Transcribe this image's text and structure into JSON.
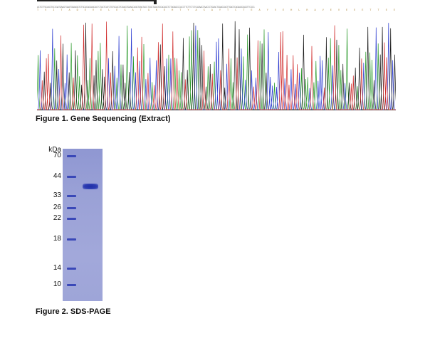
{
  "figure1": {
    "caption": "Figure 1. Gene Sequencing (Extract)",
    "base_sequence": "ACTGTTGCAGCTGCCGATGAAGTGAATGGAAGGTCTGCACAGGAGCACTCTACTCATCTGTGCACTATAAGTGAAGCAGGTGAGTACCTGGCTAAGTGCACAGCTCTAGAGCCCACCTTCTTCTCTCAGAACTAACCCTGAACTGAAGCAGTTGAGTCAGAAGCAGGTTCGCG",
    "aa_sequence": "T V I T A D E V E L E G A T G K E H T Y A S A Y T C T E A Y V E H L R A V E V E E E T T E E K P R L K E P F P F T L A A L I R G E G S E",
    "trace_colors": {
      "A": "#2a9a2a",
      "C": "#2b3bd0",
      "G": "#1a1a1a",
      "T": "#d02a2a"
    }
  },
  "figure2": {
    "caption": "Figure 2. SDS-PAGE",
    "unit_label": "kDa",
    "ladder_kda": [
      70,
      44,
      33,
      26,
      22,
      18,
      14,
      10
    ],
    "sample_band_kda": 38,
    "gel_color": "#9aa1d6",
    "band_color": "#2d3cb2"
  }
}
